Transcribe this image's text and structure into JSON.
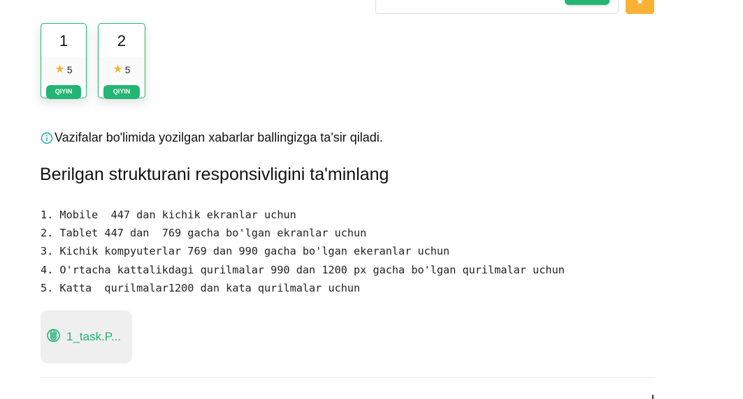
{
  "top_bar": {
    "orange_button_icon": "star-icon"
  },
  "tasks": [
    {
      "number": "1",
      "score": "5",
      "difficulty": "QIYIN"
    },
    {
      "number": "2",
      "score": "5",
      "difficulty": "QIYIN"
    }
  ],
  "info": {
    "text": "Vazifalar bo'limida yozilgan xabarlar ballingizga ta'sir qiladi.",
    "icon": "info-icon"
  },
  "task_title": "Berilgan strukturani responsivligini ta'minlang",
  "requirements": [
    "1. Mobile  447 dan kichik ekranlar uchun",
    "2. Tablet 447 dan  769 gacha bo'lgan ekranlar uchun",
    "3. Kichik kompyuterlar 769 dan 990 gacha bo'lgan ekeranlar uchun",
    "4. O'rtacha kattalikdagi qurilmalar 990 dan 1200 px gacha bo'lgan qurilmalar uchun",
    "5. Katta  qurilmalar1200 dan kata qurilmalar uchun"
  ],
  "attachment": {
    "name": "1_task.P...",
    "icon": "paperclip-icon"
  },
  "colors": {
    "accent": "#22b573",
    "star": "#f9b233"
  }
}
